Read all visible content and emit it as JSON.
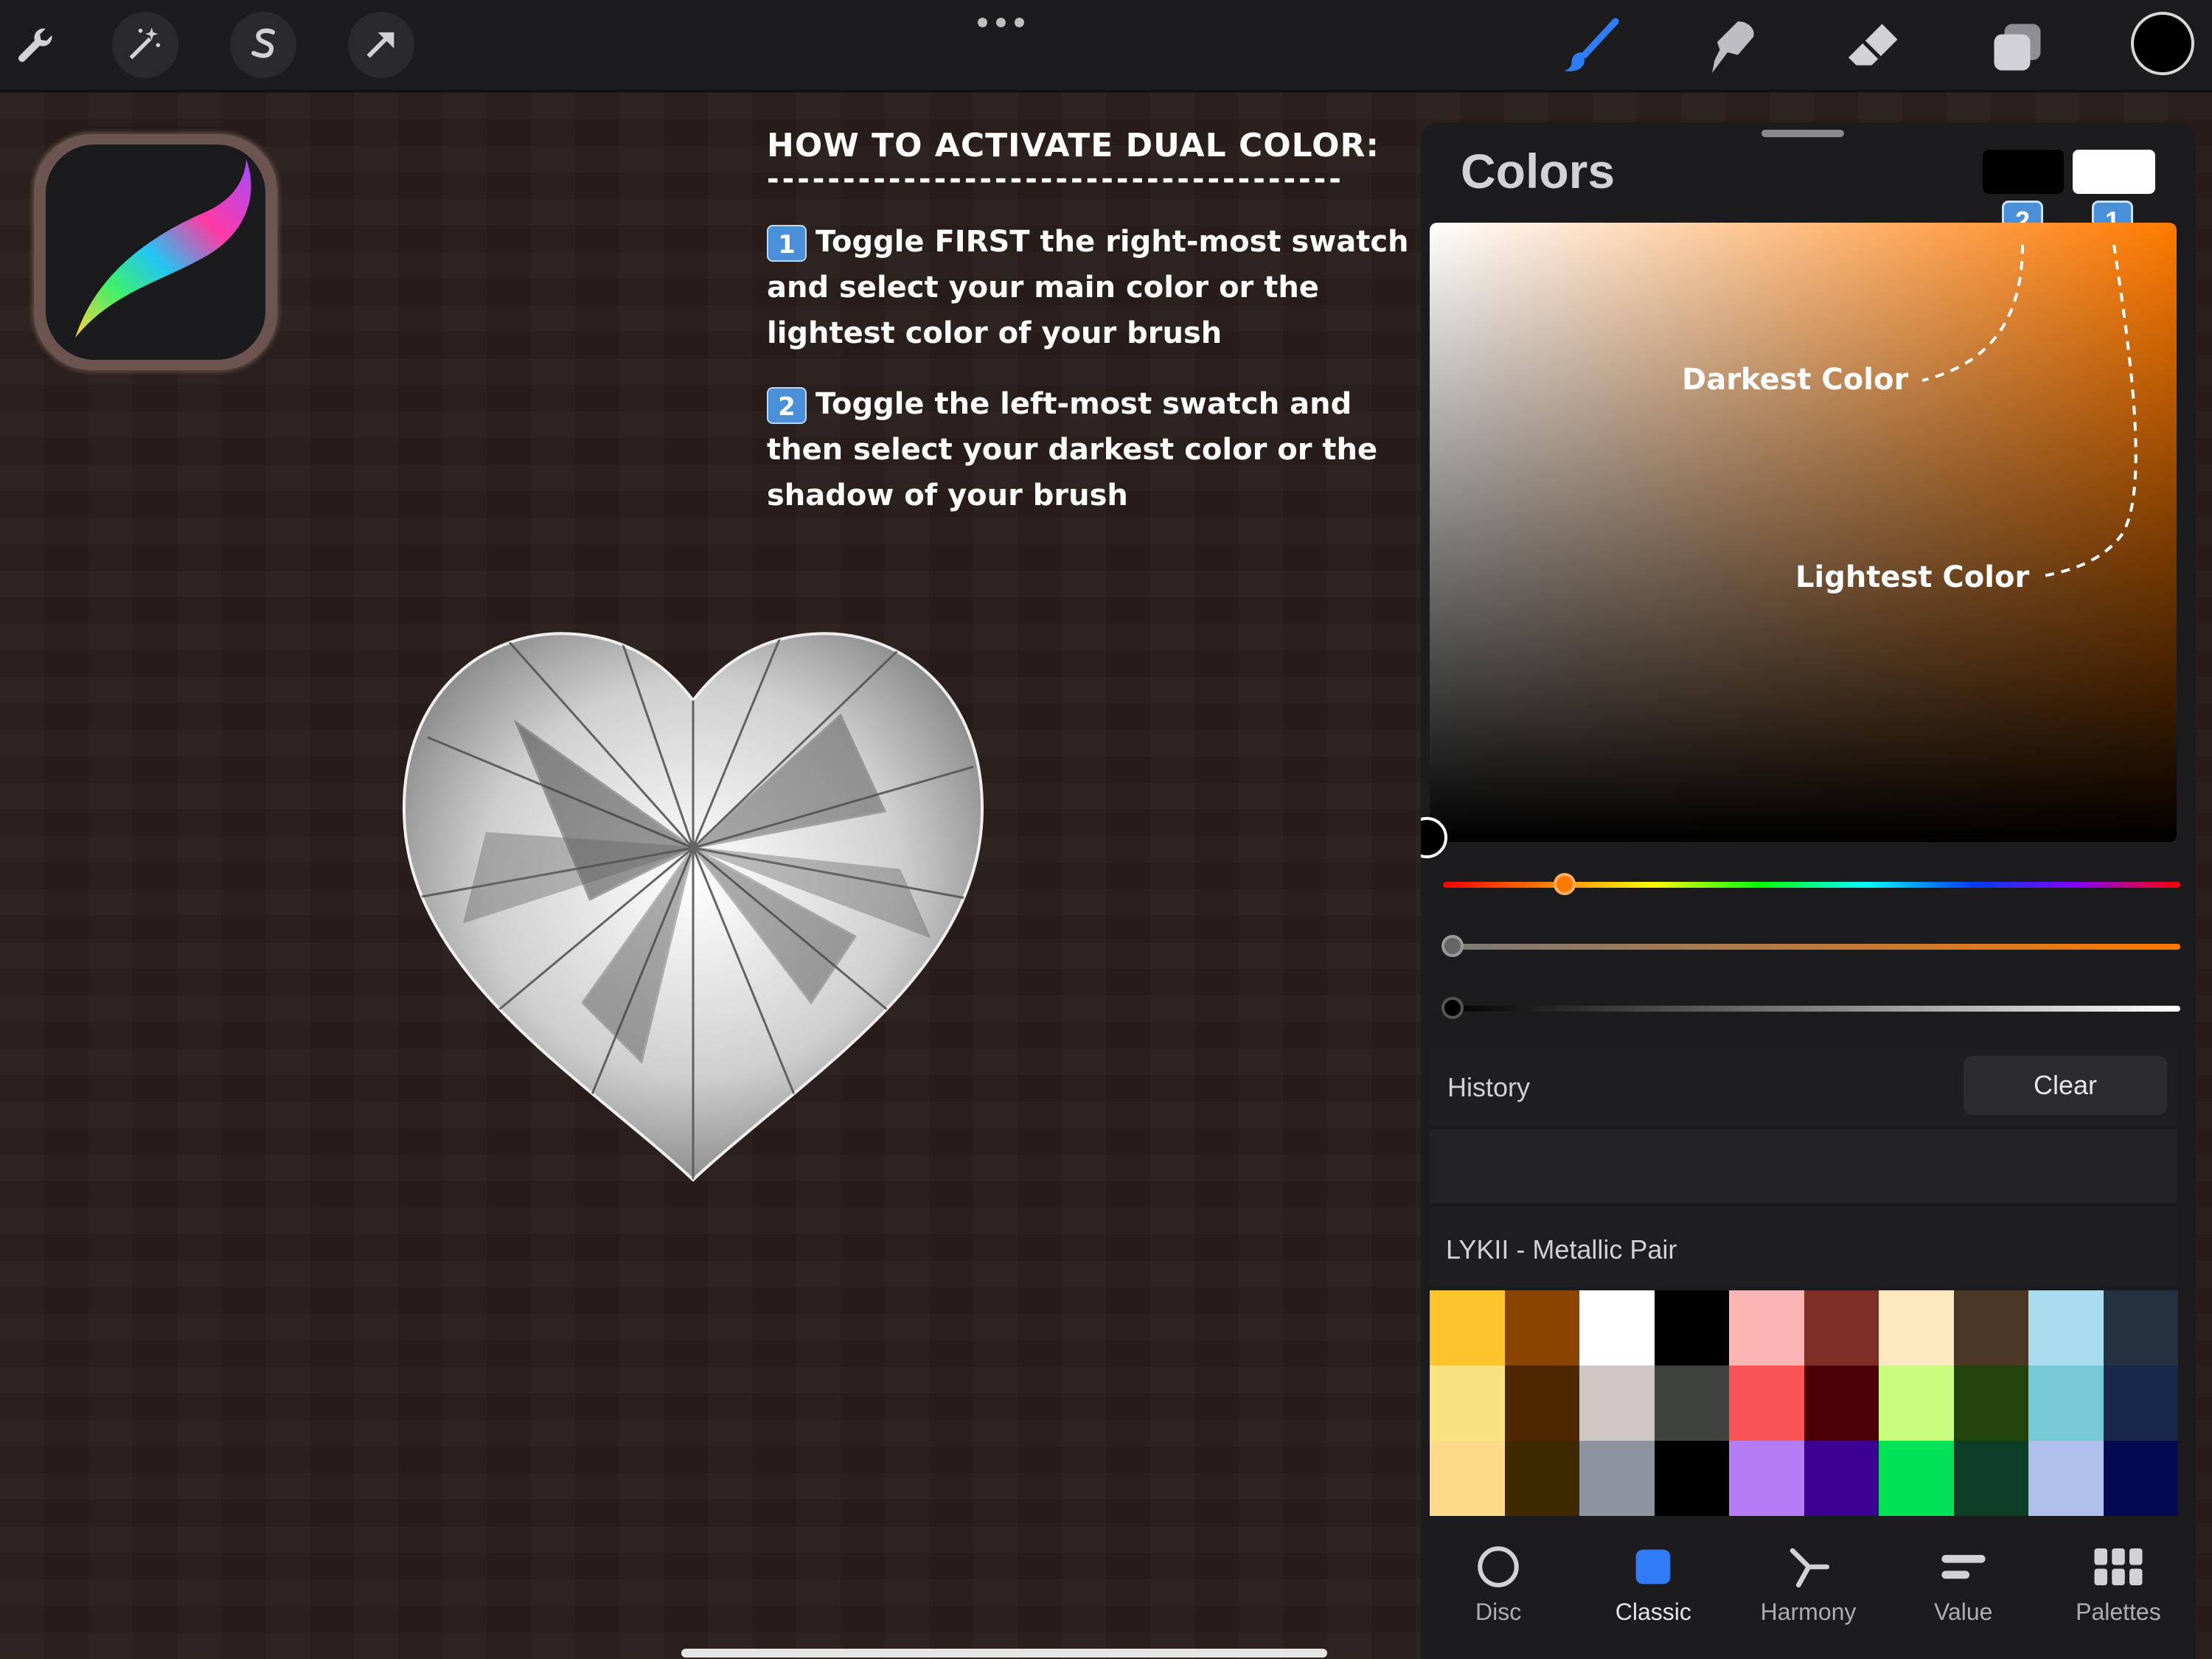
{
  "toolbar": {
    "left_icons": [
      "wrench-icon",
      "magic-wand-icon",
      "selection-s-icon",
      "arrow-transform-icon"
    ],
    "right_icons": [
      "brush-icon",
      "smudge-icon",
      "eraser-icon",
      "layers-icon"
    ],
    "current_color": "#000000",
    "brush_accent": "#2f7cf6"
  },
  "instructions": {
    "title": "HOW TO ACTIVATE DUAL COLOR:",
    "divider": "-----------------------------------------",
    "step1_key": "1",
    "step1_text": "Toggle FIRST the right-most swatch and select your main color or the lightest color of your brush",
    "step2_key": "2",
    "step2_text": "Toggle the left-most swatch and then select your darkest color or the shadow of your brush"
  },
  "panel": {
    "title": "Colors",
    "swatch_dark": "#000000",
    "swatch_light": "#ffffff",
    "badge_left": "2",
    "badge_right": "1",
    "hue_color": "#ff7a00",
    "annotation_dark": "Darkest Color",
    "annotation_light": "Lightest Color",
    "history_label": "History",
    "clear_label": "Clear",
    "palette_name": "LYKII - Metallic Pair",
    "palette": [
      [
        "#fdc52b",
        "#8a4400",
        "#ffffff",
        "#000000",
        "#fcb5b0",
        "#7f2e26",
        "#fde8c0",
        "#4a3822",
        "#a8dcee",
        "#253040"
      ],
      [
        "#f8e280",
        "#4e2700",
        "#cfc7c3",
        "#404240",
        "#fb5454",
        "#4a0006",
        "#c9fc7d",
        "#1f450a",
        "#76c8d5",
        "#17284a"
      ],
      [
        "#fdd98a",
        "#3d2a00",
        "#8e949f",
        "#000000",
        "#b57cf6",
        "#3b0092",
        "#00e158",
        "#0c3e28",
        "#afc0ec",
        "#030a52"
      ]
    ],
    "tabs": [
      {
        "label": "Disc",
        "icon": "disc-icon"
      },
      {
        "label": "Classic",
        "icon": "classic-square-icon"
      },
      {
        "label": "Harmony",
        "icon": "harmony-icon"
      },
      {
        "label": "Value",
        "icon": "value-sliders-icon"
      },
      {
        "label": "Palettes",
        "icon": "palettes-grid-icon"
      }
    ],
    "active_tab": "Classic",
    "hue_position": 0.08,
    "saturation_position": 0.0,
    "brightness_position": 0.0
  }
}
